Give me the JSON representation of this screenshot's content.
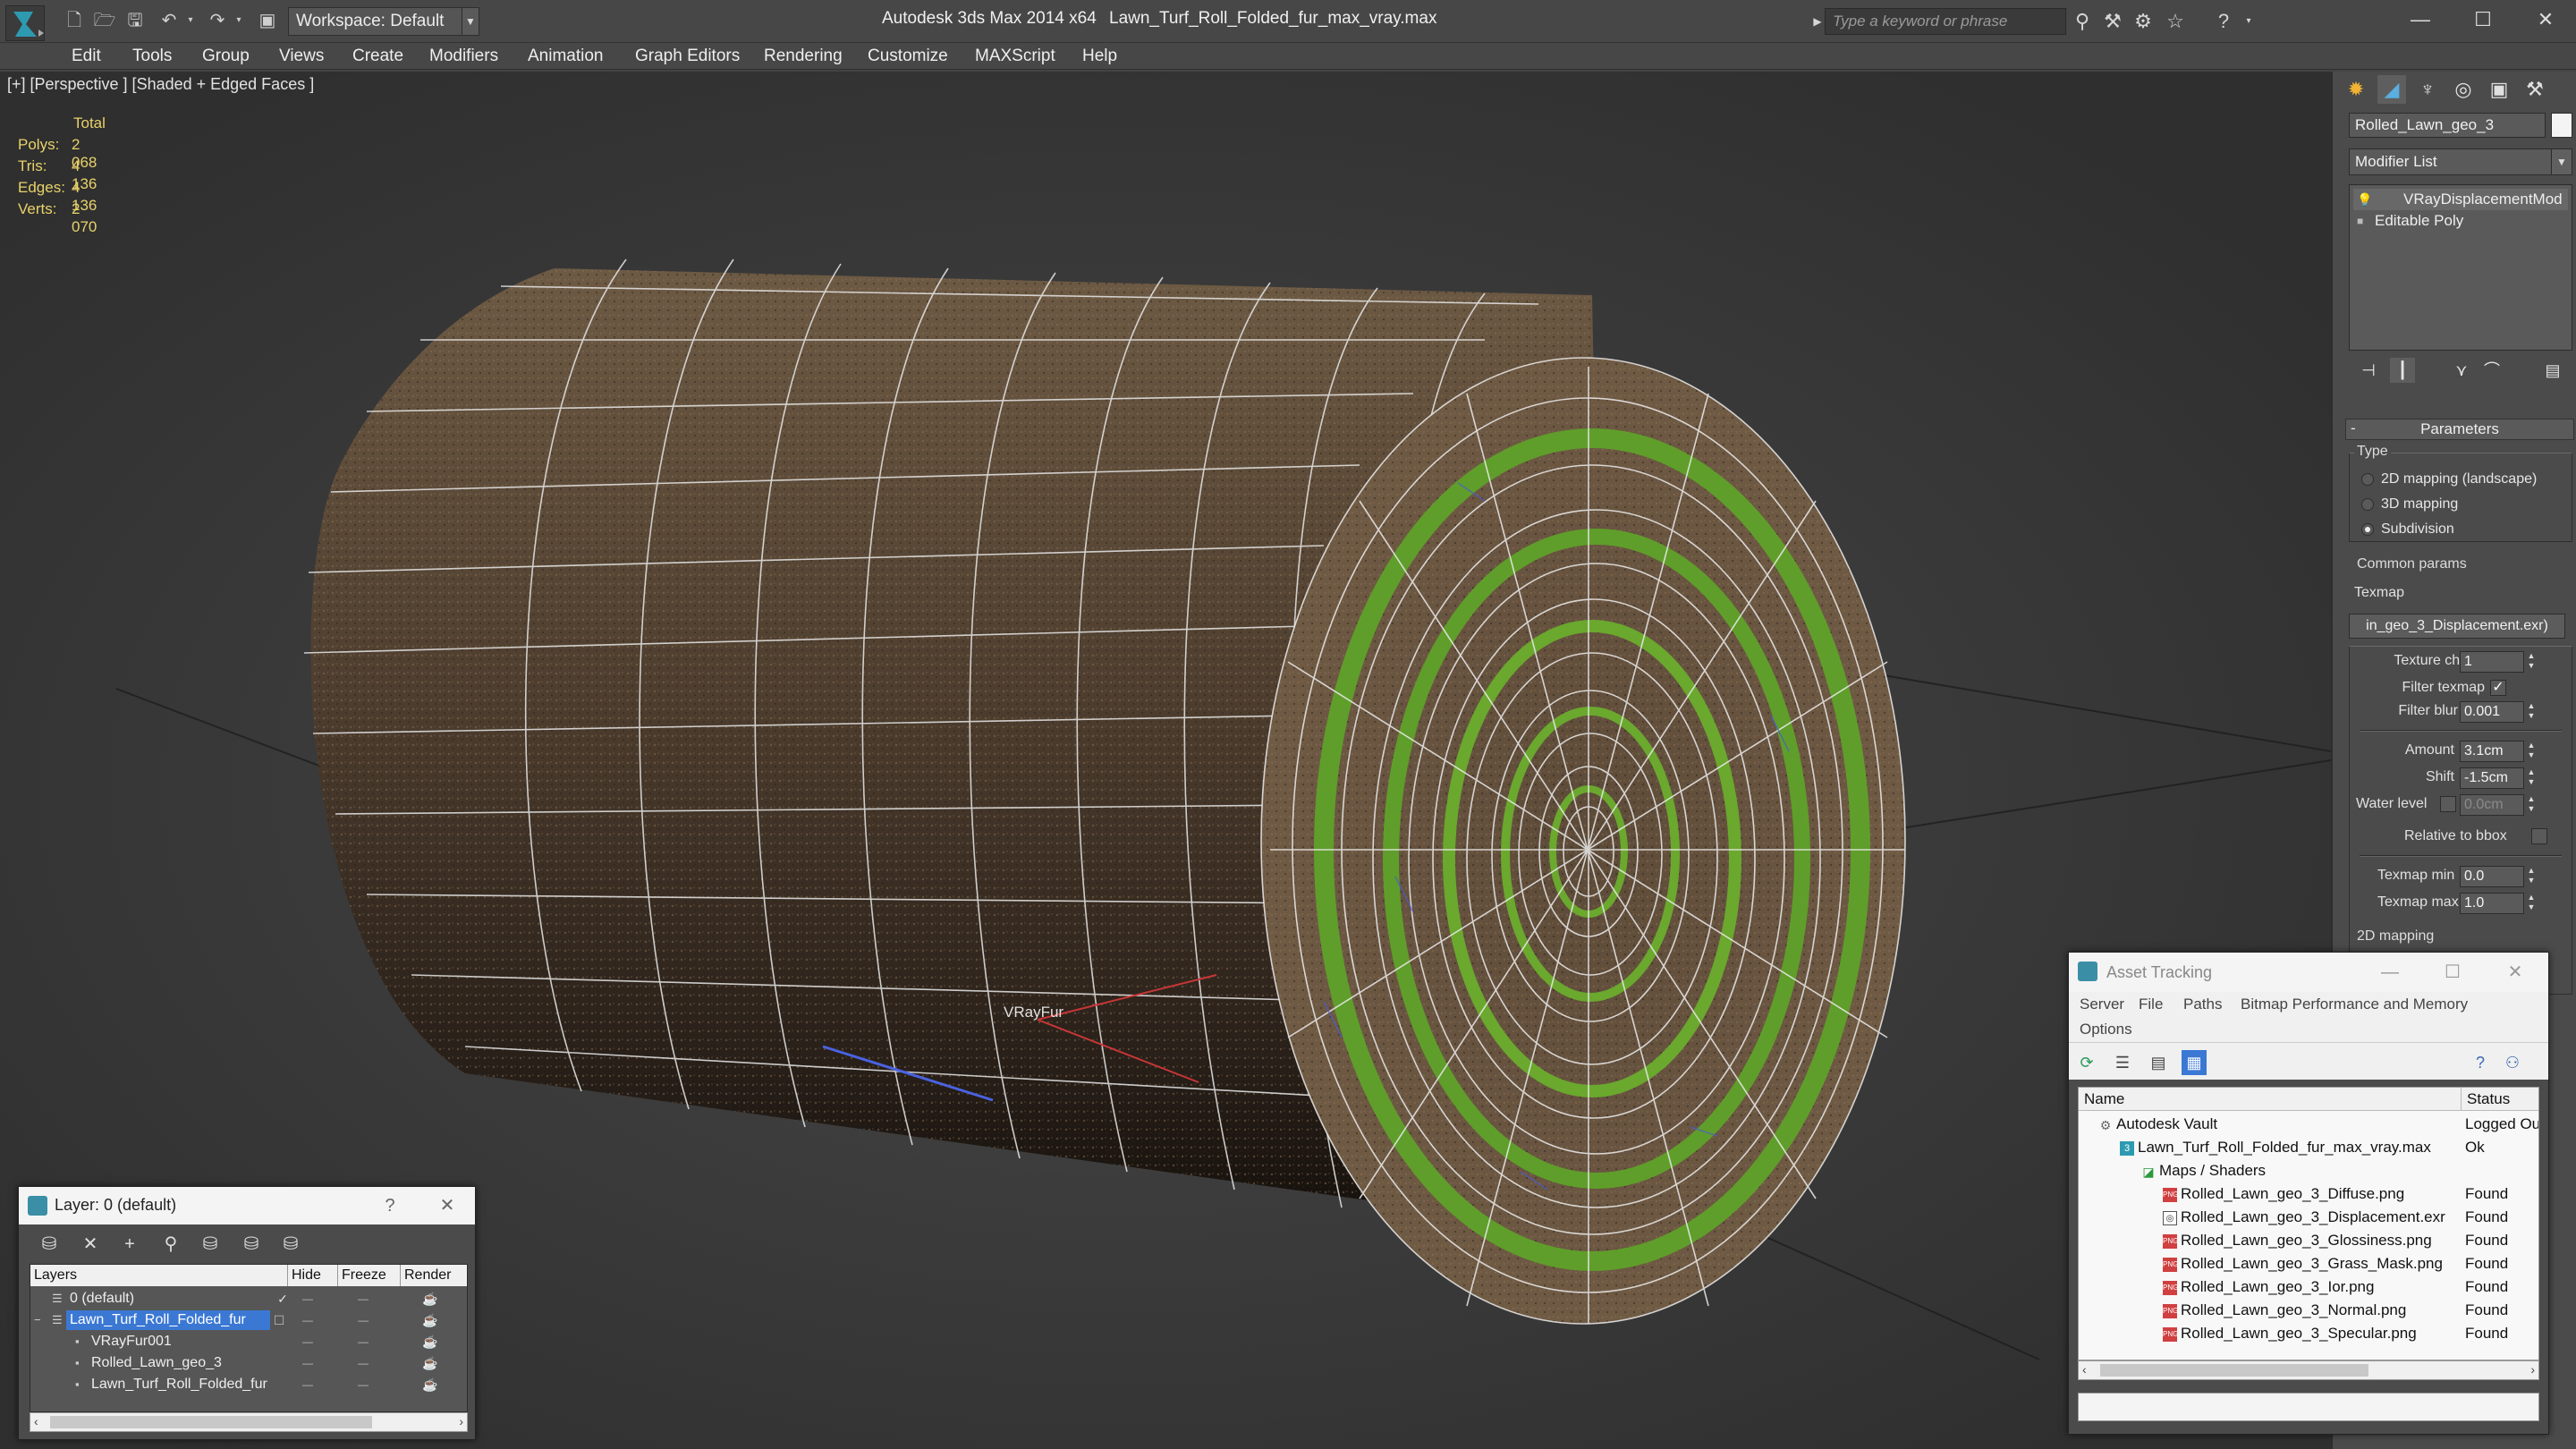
{
  "titlebar": {
    "workspace": "Workspace: Default",
    "app_title": "Autodesk 3ds Max  2014 x64",
    "file_title": "Lawn_Turf_Roll_Folded_fur_max_vray.max",
    "search_placeholder": "Type a keyword or phrase"
  },
  "menu": [
    "Edit",
    "Tools",
    "Group",
    "Views",
    "Create",
    "Modifiers",
    "Animation",
    "Graph Editors",
    "Rendering",
    "Customize",
    "MAXScript",
    "Help"
  ],
  "viewport": {
    "label": "[+] [Perspective ] [Shaded + Edged Faces ]",
    "stats": {
      "total": "Total",
      "rows": [
        {
          "label": "Polys:",
          "value": "2 068"
        },
        {
          "label": "Tris:",
          "value": "4 136"
        },
        {
          "label": "Edges:",
          "value": "4 136"
        },
        {
          "label": "Verts:",
          "value": "2 070"
        }
      ]
    },
    "object_label": "VRayFur"
  },
  "command_panel": {
    "object_name": "Rolled_Lawn_geo_3",
    "modifier_list": "Modifier List",
    "stack": [
      "VRayDisplacementMod",
      "Editable Poly"
    ],
    "rollout": "Parameters",
    "type_group": "Type",
    "type_options": [
      "2D mapping (landscape)",
      "3D mapping",
      "Subdivision"
    ],
    "common_group": "Common params",
    "texmap_label": "Texmap",
    "texmap_value": "in_geo_3_Displacement.exr)",
    "texture_chan_label": "Texture chan",
    "texture_chan_value": "1",
    "filter_texmap_label": "Filter texmap",
    "filter_blur_label": "Filter blur",
    "filter_blur_value": "0.001",
    "amount_label": "Amount",
    "amount_value": "3.1cm",
    "shift_label": "Shift",
    "shift_value": "-1.5cm",
    "water_level_label": "Water level",
    "water_level_value": "0.0cm",
    "relative_bbox_label": "Relative to bbox",
    "texmap_min_label": "Texmap min",
    "texmap_min_value": "0.0",
    "texmap_max_label": "Texmap max",
    "texmap_max_value": "1.0",
    "next_group": "2D mapping"
  },
  "layer_dialog": {
    "title": "Layer: 0 (default)",
    "help": "?",
    "columns": [
      "Layers",
      "Hide",
      "Freeze",
      "Render"
    ],
    "rows": [
      {
        "name": "0 (default)"
      },
      {
        "name": "Lawn_Turf_Roll_Folded_fur"
      },
      {
        "name": "VRayFur001"
      },
      {
        "name": "Rolled_Lawn_geo_3"
      },
      {
        "name": "Lawn_Turf_Roll_Folded_fur"
      }
    ]
  },
  "asset_tracking": {
    "title": "Asset Tracking",
    "menu": [
      "Server",
      "File",
      "Paths",
      "Bitmap Performance and Memory",
      "Options"
    ],
    "columns": [
      "Name",
      "Status"
    ],
    "rows": [
      {
        "name": "Autodesk Vault",
        "status": "Logged Ou"
      },
      {
        "name": "Lawn_Turf_Roll_Folded_fur_max_vray.max",
        "status": "Ok"
      },
      {
        "name": "Maps / Shaders",
        "status": ""
      },
      {
        "name": "Rolled_Lawn_geo_3_Diffuse.png",
        "status": "Found"
      },
      {
        "name": "Rolled_Lawn_geo_3_Displacement.exr",
        "status": "Found"
      },
      {
        "name": "Rolled_Lawn_geo_3_Glossiness.png",
        "status": "Found"
      },
      {
        "name": "Rolled_Lawn_geo_3_Grass_Mask.png",
        "status": "Found"
      },
      {
        "name": "Rolled_Lawn_geo_3_Ior.png",
        "status": "Found"
      },
      {
        "name": "Rolled_Lawn_geo_3_Normal.png",
        "status": "Found"
      },
      {
        "name": "Rolled_Lawn_geo_3_Specular.png",
        "status": "Found"
      }
    ]
  }
}
